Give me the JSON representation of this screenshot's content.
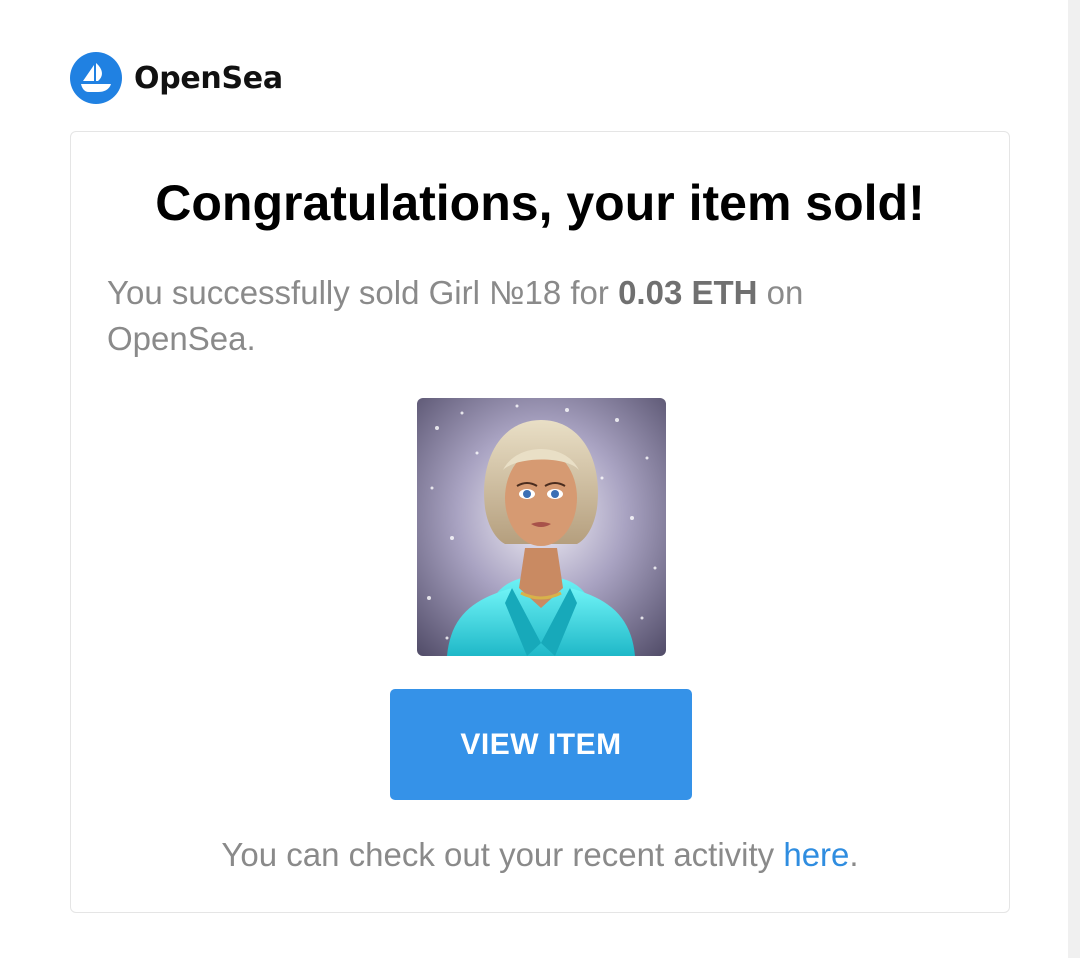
{
  "brand": {
    "name": "OpenSea",
    "logo_icon": "opensea-ship-icon",
    "accent_color": "#2081e2"
  },
  "email": {
    "headline": "Congratulations, your item sold!",
    "message": {
      "prefix": "You successfully sold Girl №18 for ",
      "price": "0.03 ETH",
      "suffix": " on OpenSea."
    },
    "item_image": {
      "icon": "nft-girl-portrait-image",
      "alt": "Girl №18"
    },
    "view_button_label": "VIEW ITEM",
    "button_color": "#3592e8",
    "footer": {
      "text": "You can check out your recent activity ",
      "link_text": "here",
      "end": "."
    },
    "link_color": "#2f8de0"
  }
}
